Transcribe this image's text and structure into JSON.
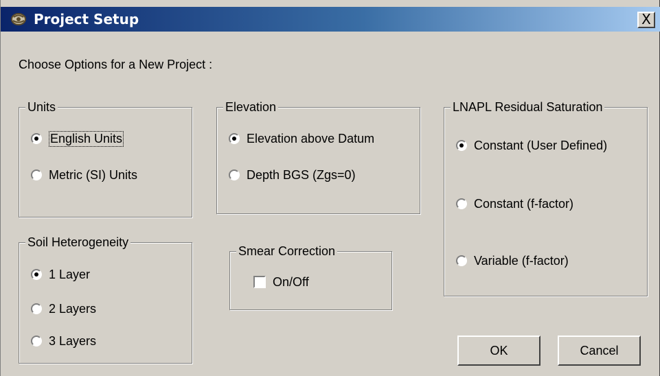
{
  "window": {
    "title": "Project Setup",
    "close_glyph": "X",
    "icon": "app-gear-icon"
  },
  "subtitle": "Choose Options for a New Project :",
  "units": {
    "legend": "Units",
    "options": [
      {
        "label": "English Units",
        "checked": true
      },
      {
        "label": "Metric (SI) Units",
        "checked": false
      }
    ]
  },
  "elevation": {
    "legend": "Elevation",
    "options": [
      {
        "label": "Elevation above Datum",
        "checked": true
      },
      {
        "label": "Depth BGS (Zgs=0)",
        "checked": false
      }
    ]
  },
  "lnapl": {
    "legend": "LNAPL Residual Saturation",
    "options": [
      {
        "label": "Constant (User Defined)",
        "checked": true
      },
      {
        "label": "Constant (f-factor)",
        "checked": false
      },
      {
        "label": "Variable (f-factor)",
        "checked": false
      }
    ]
  },
  "soil": {
    "legend": "Soil Heterogeneity",
    "options": [
      {
        "label": "1 Layer",
        "checked": true
      },
      {
        "label": "2 Layers",
        "checked": false
      },
      {
        "label": "3 Layers",
        "checked": false
      }
    ]
  },
  "smear": {
    "legend": "Smear Correction",
    "checkbox_label": "On/Off",
    "checked": false
  },
  "buttons": {
    "ok": "OK",
    "cancel": "Cancel"
  }
}
